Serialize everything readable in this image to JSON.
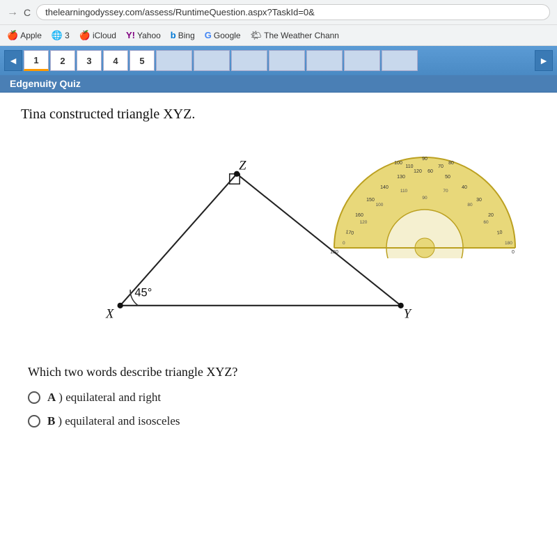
{
  "browser": {
    "url": "thelearningodyssey.com/assess/RuntimeQuestion.aspx?TaskId=0&",
    "nav_back": "→",
    "nav_forward": "→",
    "refresh": "C"
  },
  "bookmarks": [
    {
      "label": "Apple",
      "icon": "🍎"
    },
    {
      "label": "3",
      "icon": "🌐"
    },
    {
      "label": "iCloud",
      "icon": ""
    },
    {
      "label": "Yahoo",
      "icon": "Y!"
    },
    {
      "label": "Bing",
      "icon": "b"
    },
    {
      "label": "Google",
      "icon": "G"
    },
    {
      "label": "The Weather Chann",
      "icon": ""
    }
  ],
  "tab_nav": {
    "left_arrow": "◄",
    "right_arrow": "►",
    "tabs": [
      "1",
      "2",
      "3",
      "4",
      "5"
    ]
  },
  "quiz_label": "Edgenuity Quiz",
  "question": {
    "text": "Tina constructed triangle XYZ.",
    "diagram": {
      "vertex_x": "X",
      "vertex_y": "Y",
      "vertex_z": "Z",
      "angle_label": "45°"
    },
    "which_words": "Which two words describe triangle XYZ?",
    "options": [
      {
        "id": "A",
        "text": "equilateral and right"
      },
      {
        "id": "B",
        "text": "equilateral and isosceles"
      }
    ]
  }
}
